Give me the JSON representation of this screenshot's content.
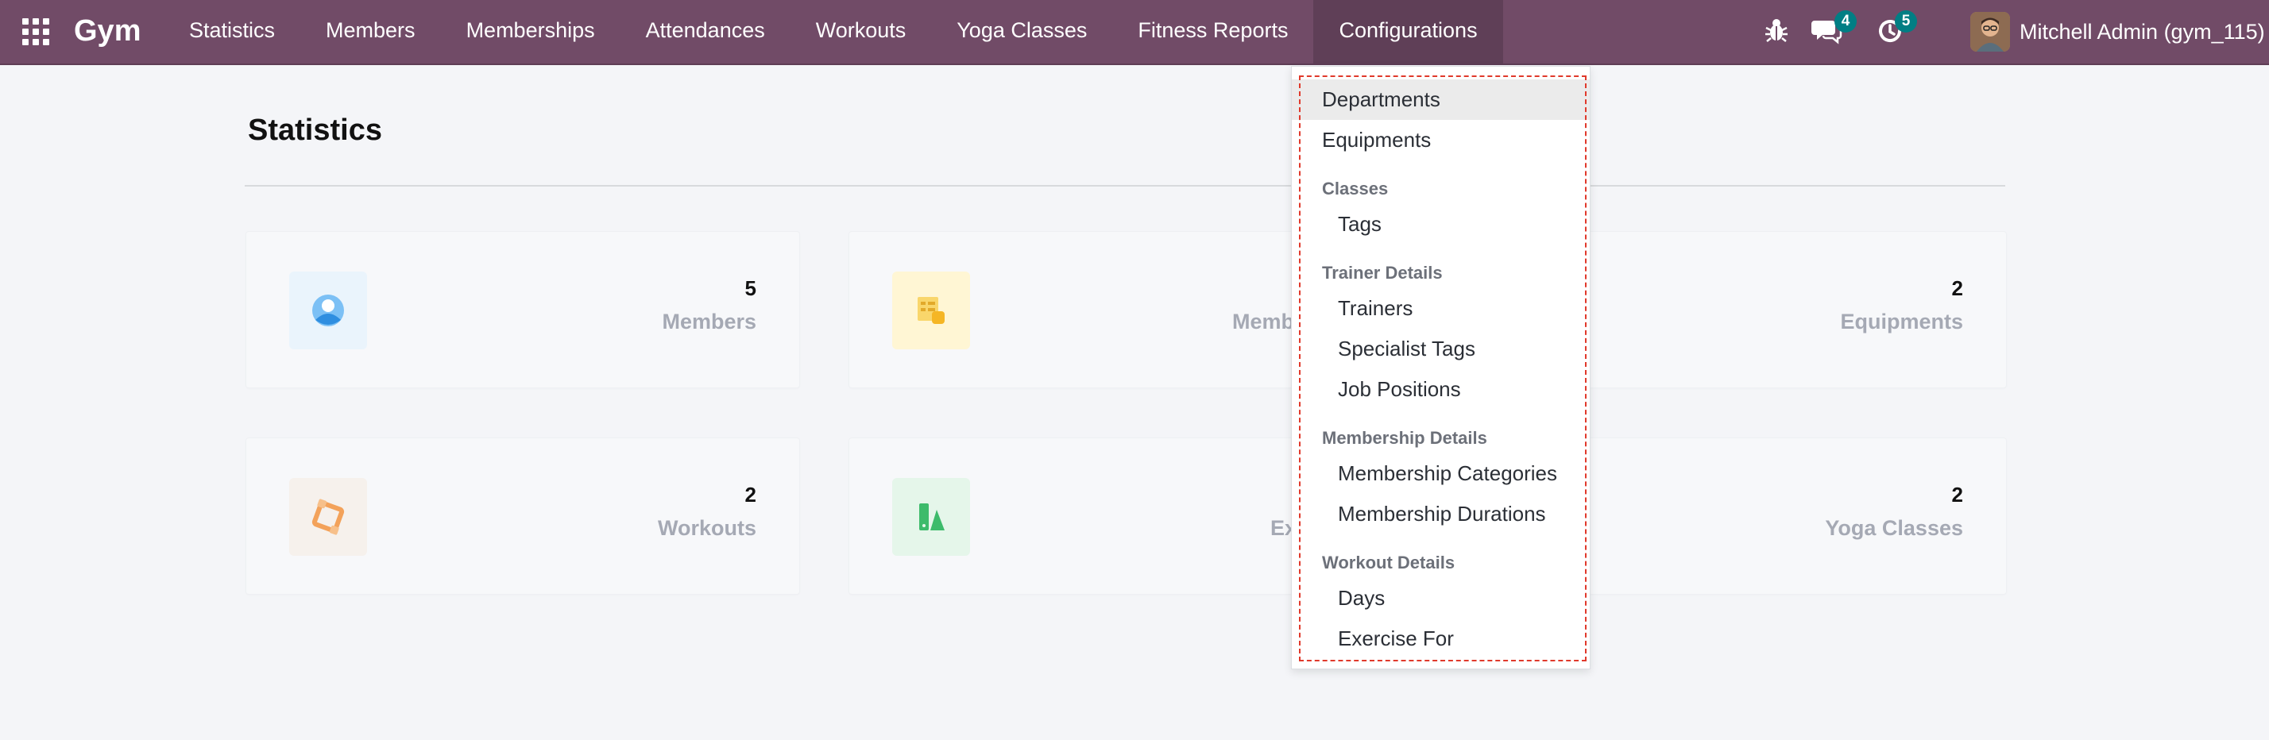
{
  "app": {
    "brand": "Gym"
  },
  "menu": [
    {
      "label": "Statistics"
    },
    {
      "label": "Members"
    },
    {
      "label": "Memberships"
    },
    {
      "label": "Attendances"
    },
    {
      "label": "Workouts"
    },
    {
      "label": "Yoga Classes"
    },
    {
      "label": "Fitness Reports"
    },
    {
      "label": "Configurations"
    }
  ],
  "systray": {
    "chat_badge": "4",
    "activity_badge": "5",
    "user_name": "Mitchell Admin (gym_115)"
  },
  "page": {
    "title": "Statistics"
  },
  "cards": [
    {
      "value": "5",
      "label": "Members",
      "icon": "member-icon",
      "color": "#e8f4fd"
    },
    {
      "value": "",
      "label": "Memb",
      "icon": "membership-icon",
      "color": "#fff7d6"
    },
    {
      "value": "2",
      "label": "Equipments",
      "icon": "",
      "color": ""
    },
    {
      "value": "2",
      "label": "Workouts",
      "icon": "workout-icon",
      "color": "#fdf3ea"
    },
    {
      "value": "",
      "label": "Ex",
      "icon": "exercise-icon",
      "color": "#e6f7ec"
    },
    {
      "value": "2",
      "label": "Yoga Classes",
      "icon": "",
      "color": ""
    }
  ],
  "dropdown": {
    "departments": "Departments",
    "equipments": "Equipments",
    "classes_header": "Classes",
    "tags": "Tags",
    "trainer_header": "Trainer Details",
    "trainers": "Trainers",
    "specialist_tags": "Specialist Tags",
    "job_positions": "Job Positions",
    "membership_header": "Membership Details",
    "membership_categories": "Membership Categories",
    "membership_durations": "Membership Durations",
    "workout_header": "Workout Details",
    "days": "Days",
    "exercise_for": "Exercise For"
  },
  "colors": {
    "navbar": "#714b67",
    "badge": "#017e84",
    "highlight": "#e0392b"
  }
}
